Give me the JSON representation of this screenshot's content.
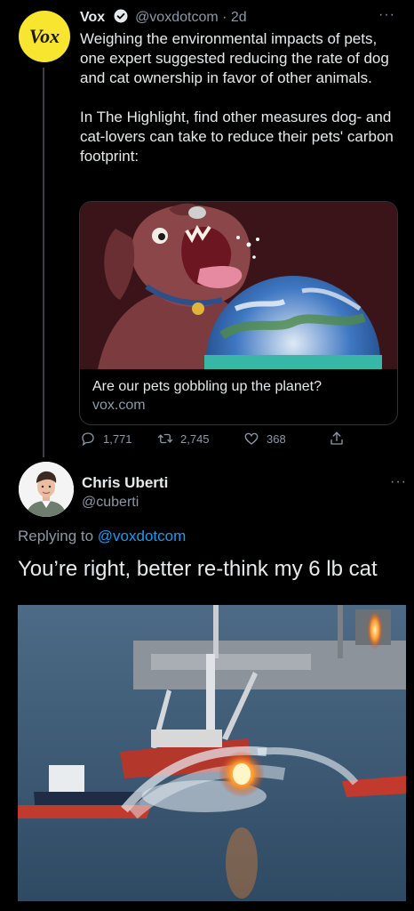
{
  "tweet": {
    "avatar_text": "Vox",
    "name": "Vox",
    "handle": "@voxdotcom",
    "separator": "·",
    "time": "2d",
    "more": "···",
    "paragraph1": "Weighing the environmental impacts of pets, one expert suggested reducing the rate of dog and cat ownership in favor of other animals.",
    "paragraph2": "In The Highlight, find other measures dog- and cat-lovers can take to reduce their pets' carbon footprint:",
    "card": {
      "title": "Are our pets gobbling up the planet?",
      "domain": "vox.com"
    },
    "actions": {
      "replies": "1,771",
      "retweets": "2,745",
      "likes": "368"
    }
  },
  "reply": {
    "name": "Chris Uberti",
    "handle": "@cuberti",
    "more": "···",
    "replying_prefix": "Replying to ",
    "replying_handle": "@voxdotcom",
    "text": "You’re right, better re-think my 6 lb cat"
  },
  "colors": {
    "background": "#000000",
    "text": "#e7e9ea",
    "muted": "#8b98a5",
    "link": "#1d9bf0",
    "vox_yellow": "#f7e530"
  },
  "icons": [
    "verified-icon",
    "more-icon",
    "reply-icon",
    "retweet-icon",
    "like-icon",
    "share-icon"
  ]
}
